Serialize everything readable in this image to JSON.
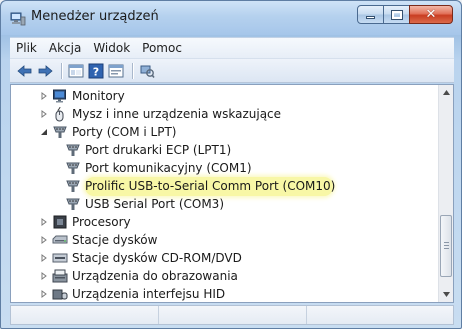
{
  "window": {
    "title": "Menedżer urządzeń",
    "title_icon": "device-manager-icon",
    "controls": [
      "minimize-icon",
      "maximize-icon",
      "close-icon"
    ]
  },
  "menubar": {
    "items": [
      "Plik",
      "Akcja",
      "Widok",
      "Pomoc"
    ]
  },
  "toolbar": {
    "buttons": [
      "back-arrow-icon",
      "forward-arrow-icon",
      "show-hide-console-tree-icon",
      "help-icon",
      "properties-icon",
      "scan-hardware-icon"
    ]
  },
  "tree": {
    "items": [
      {
        "label": "Monitory",
        "icon": "monitor-icon",
        "level": 0,
        "expander": "collapsed"
      },
      {
        "label": "Mysz i inne urządzenia wskazujące",
        "icon": "mouse-icon",
        "level": 0,
        "expander": "collapsed"
      },
      {
        "label": "Porty (COM i LPT)",
        "icon": "port-icon",
        "level": 0,
        "expander": "expanded"
      },
      {
        "label": "Port drukarki ECP (LPT1)",
        "icon": "port-icon",
        "level": 1,
        "expander": "none"
      },
      {
        "label": "Port komunikacyjny (COM1)",
        "icon": "port-icon",
        "level": 1,
        "expander": "none"
      },
      {
        "label": "Prolific USB-to-Serial Comm Port (COM10)",
        "icon": "port-icon",
        "level": 1,
        "expander": "none",
        "highlighted": true
      },
      {
        "label": "USB Serial Port (COM3)",
        "icon": "port-icon",
        "level": 1,
        "expander": "none"
      },
      {
        "label": "Procesory",
        "icon": "processor-icon",
        "level": 0,
        "expander": "collapsed"
      },
      {
        "label": "Stacje dysków",
        "icon": "disk-drive-icon",
        "level": 0,
        "expander": "collapsed"
      },
      {
        "label": "Stacje dysków CD-ROM/DVD",
        "icon": "cdrom-icon",
        "level": 0,
        "expander": "collapsed"
      },
      {
        "label": "Urządzenia do obrazowania",
        "icon": "imaging-device-icon",
        "level": 0,
        "expander": "collapsed"
      },
      {
        "label": "Urządzenia interfejsu HID",
        "icon": "hid-icon",
        "level": 0,
        "expander": "collapsed"
      }
    ]
  },
  "colors": {
    "highlight": "#f8f7a6",
    "title_bar": "#b5d1ee",
    "close_button": "#c93d22"
  }
}
